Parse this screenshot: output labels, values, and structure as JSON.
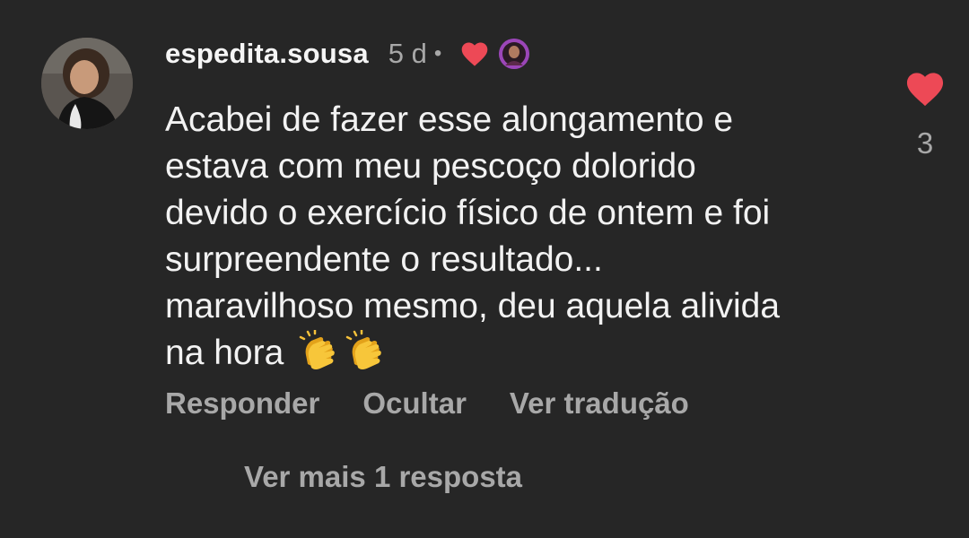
{
  "comment": {
    "username": "espedita.sousa",
    "time": "5 d",
    "separator": "•",
    "text": "Acabei de fazer esse alongamento e\nestava com meu pescoço dolorido\ndevido o exercício físico de ontem e foi\nsurpreendente o resultado...\nmaravilhoso mesmo, deu aquela alivida\nna hora",
    "emoji_icons": [
      "clapping-hands-icon",
      "clapping-hands-icon"
    ],
    "like_count": "3",
    "actions": {
      "reply": "Responder",
      "hide": "Ocultar",
      "translate": "Ver tradução"
    },
    "view_replies": "Ver mais 1 resposta"
  },
  "colors": {
    "background": "#262626",
    "primary_text": "#f2f2f2",
    "secondary_text": "#a8a8a8",
    "heart": "#ed4956"
  }
}
